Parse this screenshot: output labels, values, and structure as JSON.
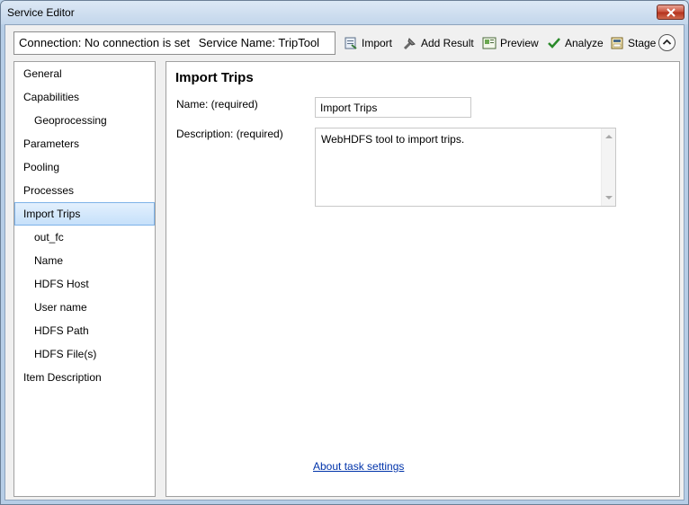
{
  "window": {
    "title": "Service Editor"
  },
  "toolbar": {
    "connection_text": "Connection: No connection is set",
    "service_name_text": "Service Name: TripTool",
    "buttons": [
      {
        "label": "Import",
        "icon": "import-icon"
      },
      {
        "label": "Add Result",
        "icon": "add-result-icon"
      },
      {
        "label": "Preview",
        "icon": "preview-icon"
      },
      {
        "label": "Analyze",
        "icon": "checkmark-icon"
      },
      {
        "label": "Stage",
        "icon": "stage-icon"
      }
    ]
  },
  "nav": {
    "items": [
      {
        "label": "General",
        "level": 0
      },
      {
        "label": "Capabilities",
        "level": 0
      },
      {
        "label": "Geoprocessing",
        "level": 1
      },
      {
        "label": "Parameters",
        "level": 0
      },
      {
        "label": "Pooling",
        "level": 0
      },
      {
        "label": "Processes",
        "level": 0
      },
      {
        "label": "Import Trips",
        "level": 0,
        "selected": true
      },
      {
        "label": "out_fc",
        "level": 1
      },
      {
        "label": "Name",
        "level": 1
      },
      {
        "label": "HDFS Host",
        "level": 1
      },
      {
        "label": "User name",
        "level": 1
      },
      {
        "label": "HDFS Path",
        "level": 1
      },
      {
        "label": "HDFS File(s)",
        "level": 1
      },
      {
        "label": "Item Description",
        "level": 0
      }
    ]
  },
  "content": {
    "title": "Import Trips",
    "name_label": "Name:  (required)",
    "name_value": "Import Trips",
    "description_label": "Description:  (required)",
    "description_value": "WebHDFS tool to import trips.",
    "about_link": "About task settings"
  },
  "colors": {
    "selection_bg": "#c6e0fa",
    "selection_border": "#7db2e8",
    "link": "#0033aa",
    "analyze_check": "#2a8a2a",
    "close_button": "#c9503b"
  }
}
